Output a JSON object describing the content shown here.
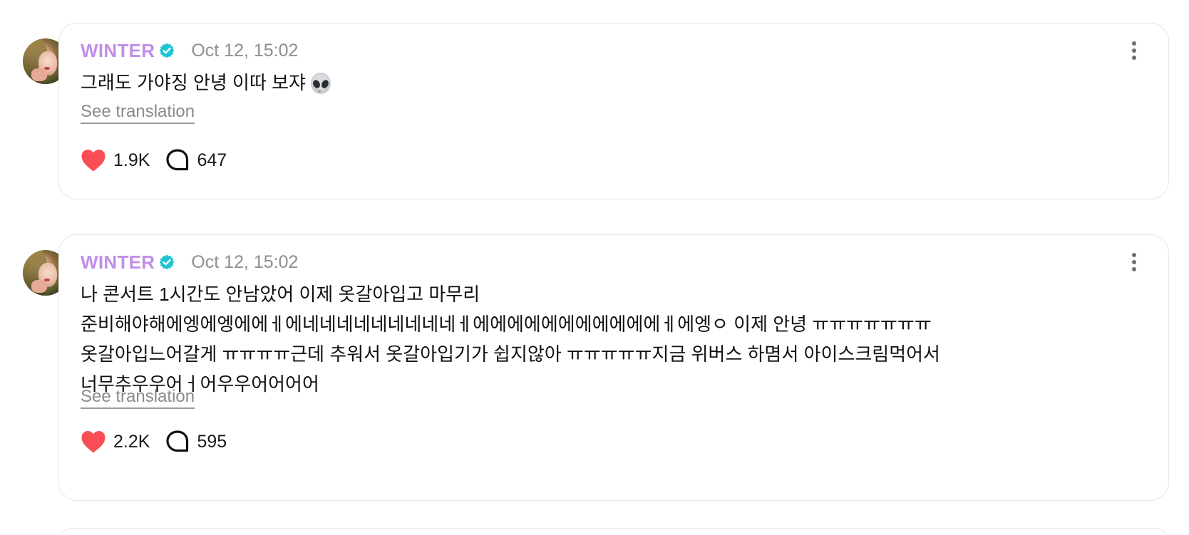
{
  "posts": [
    {
      "author": "WINTER",
      "timestamp": "Oct 12, 15:02",
      "text": "그래도 가야징 안녕 이따 보쟈",
      "emoji": "alien-emoji",
      "translate_label": "See translation",
      "likes": "1.9K",
      "comments": "647"
    },
    {
      "author": "WINTER",
      "timestamp": "Oct 12, 15:02",
      "text": "나 콘서트 1시간도 안남았어 이제 옷갈아입고 마무리\n준비해야해에엥에엥에에ㅔ에네네네네네네네네네ㅔ에에에에에에에에에에에ㅔ에엥ㅇ 이제 안녕 ㅠㅠㅠㅠㅠㅠㅠ\n옷갈아입느어갈게 ㅠㅠㅠㅠ근데 추워서 옷갈아입기가 쉽지않아 ㅠㅠㅠㅠㅠ지금 위버스 하몀서 아이스크림먹어서\n너무추우우어ㅓ어우우어어어어",
      "translate_label": "See translation",
      "likes": "2.2K",
      "comments": "595"
    }
  ],
  "icons": {
    "verified": "verified-badge-icon",
    "like": "heart-icon",
    "comment": "comment-bubble-icon",
    "more": "more-vertical-icon"
  },
  "colors": {
    "author": "#c18ee8",
    "verified": "#1fc4d4",
    "heart": "#fa4e57",
    "timestamp": "#8f8f8f"
  }
}
